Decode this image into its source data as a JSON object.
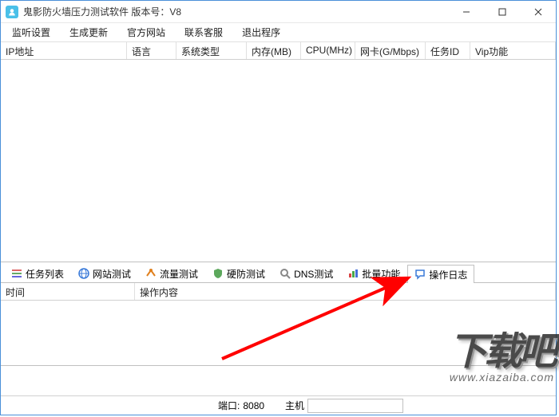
{
  "window": {
    "title": "鬼影防火墙压力测试软件 版本号：V8"
  },
  "menu": {
    "items": [
      "监听设置",
      "生成更新",
      "官方网站",
      "联系客服",
      "退出程序"
    ]
  },
  "top_grid": {
    "columns": [
      "IP地址",
      "语言",
      "系统类型",
      "内存(MB)",
      "CPU(MHz)",
      "网卡(G/Mbps)",
      "任务ID",
      "Vip功能"
    ]
  },
  "tabs": {
    "items": [
      "任务列表",
      "网站测试",
      "流量测试",
      "硬防测试",
      "DNS测试",
      "批量功能",
      "操作日志"
    ],
    "active_index": 6,
    "icons": [
      "list-icon",
      "globe-icon",
      "flow-icon",
      "shield-icon",
      "search-icon",
      "bars-icon",
      "speech-icon"
    ]
  },
  "lower_grid": {
    "columns": [
      "时间",
      "操作内容"
    ]
  },
  "status": {
    "port_label": "端口:",
    "port_value": "8080",
    "host_label": "主机"
  },
  "watermark": {
    "big": "下载吧",
    "small": "www.xiazaiba.com"
  }
}
